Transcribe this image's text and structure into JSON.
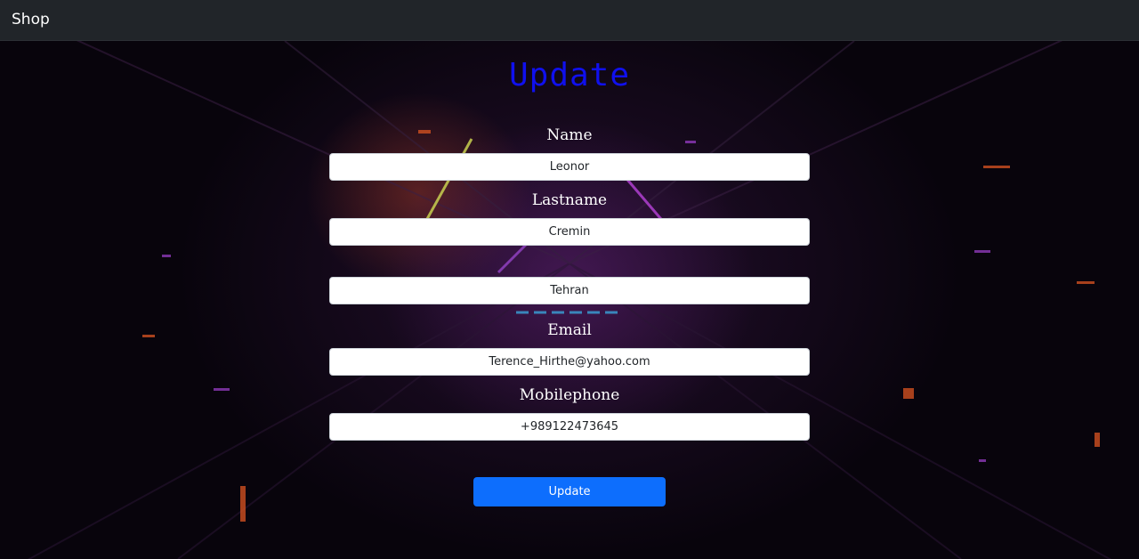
{
  "navbar": {
    "brand": "Shop"
  },
  "page": {
    "title": "Update"
  },
  "form": {
    "name": {
      "label": "Name",
      "value": "Leonor"
    },
    "lastname": {
      "label": "Lastname",
      "value": "Cremin"
    },
    "city": {
      "label": "",
      "value": "Tehran"
    },
    "email": {
      "label": "Email",
      "value": "Terence_Hirthe@yahoo.com"
    },
    "mobilephone": {
      "label": "Mobilephone",
      "value": "+989122473645"
    },
    "submit_label": "Update"
  },
  "colors": {
    "navbar_bg": "#212529",
    "title": "#1010ee",
    "button": "#0d6efd"
  }
}
